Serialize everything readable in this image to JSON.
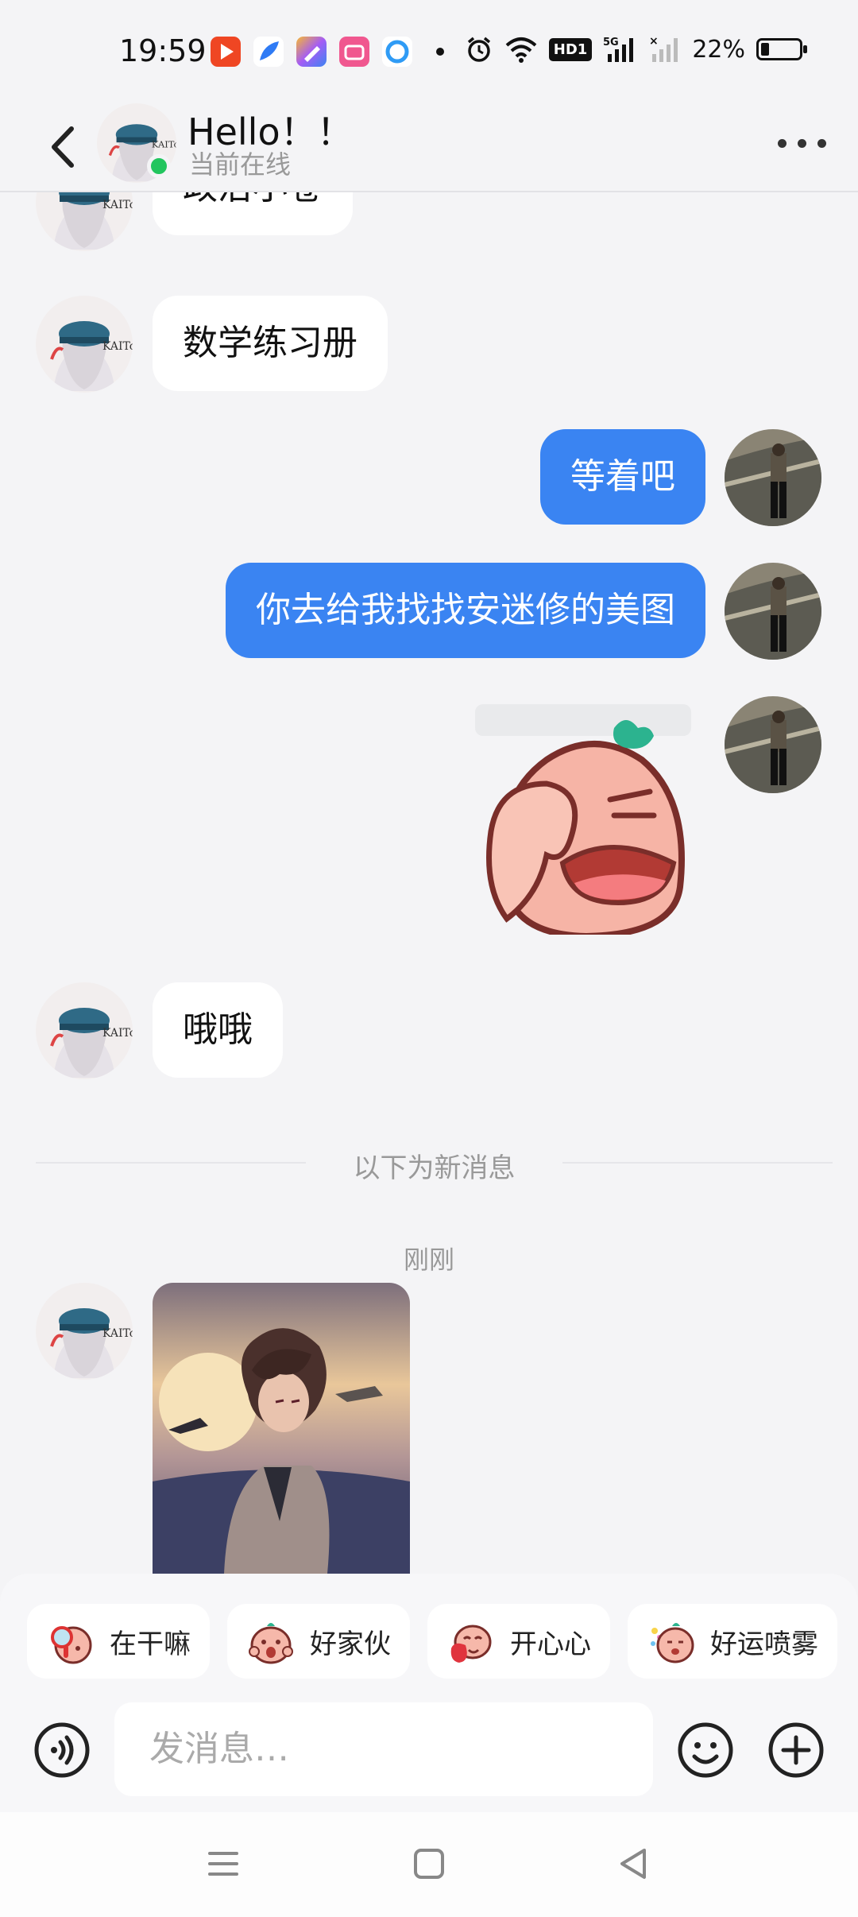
{
  "status_bar": {
    "time": "19:59",
    "battery_text": "22%",
    "battery_level": 0.22,
    "network": "5G",
    "hd_badge": "HD1",
    "app_icons": [
      "video-app-icon",
      "feather-app-icon",
      "pen-app-icon",
      "bilibili-icon",
      "browser-icon"
    ]
  },
  "header": {
    "title": "Hello！！",
    "status": "当前在线",
    "more_icon": "more-dots-icon",
    "back_icon": "back-chevron-icon"
  },
  "messages": {
    "m1": "政治小卷",
    "m2": "数学练习册",
    "m3": "等着吧",
    "m4": "你去给我找找安迷修的美图",
    "m5_sticker": "facepalm-sticker",
    "m6": "哦哦",
    "divider": "以下为新消息",
    "time": "刚刚",
    "m7_image": "anime-character-image"
  },
  "quick_replies": [
    {
      "label": "在干嘛",
      "icon": "magnifier-sticker-icon"
    },
    {
      "label": "好家伙",
      "icon": "shocked-sticker-icon"
    },
    {
      "label": "开心心",
      "icon": "happy-sticker-icon"
    },
    {
      "label": "好运喷雾",
      "icon": "lucky-spray-sticker-icon"
    }
  ],
  "composer": {
    "placeholder": "发消息…",
    "voice_icon": "voice-icon",
    "emoji_icon": "emoji-icon",
    "plus_icon": "plus-icon"
  },
  "colors": {
    "out_bubble": "#3a84f2",
    "in_bubble": "#ffffff",
    "background": "#f4f4f6",
    "online": "#22c55e"
  }
}
